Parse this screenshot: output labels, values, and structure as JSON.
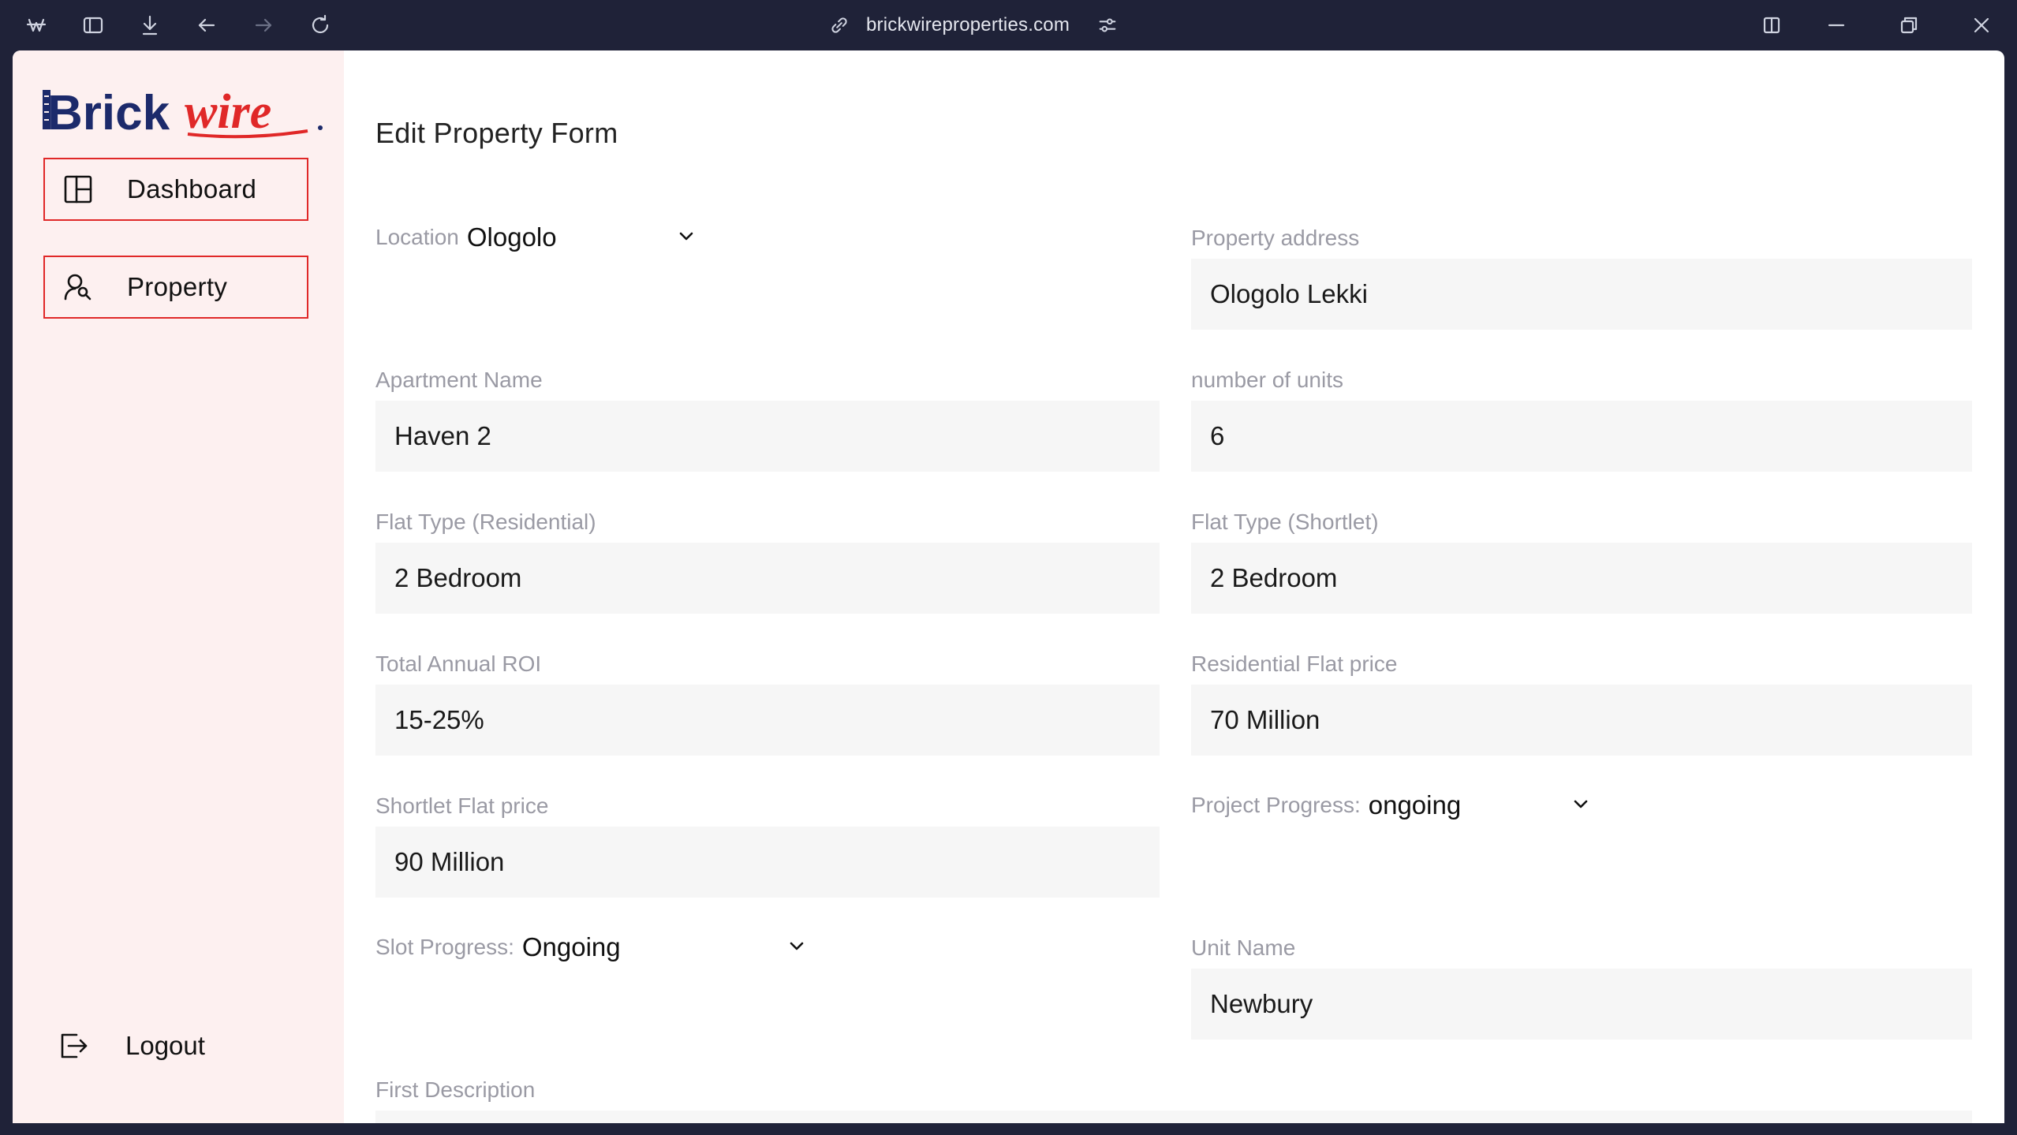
{
  "browser": {
    "url": "brickwireproperties.com"
  },
  "sidebar": {
    "logo_text": "Brickwire",
    "items": [
      {
        "label": "Dashboard",
        "icon": "dashboard-layout-icon"
      },
      {
        "label": "Property",
        "icon": "user-search-icon"
      }
    ],
    "logout_label": "Logout"
  },
  "form": {
    "title": "Edit Property Form",
    "location": {
      "label": "Location",
      "value": "Ologolo"
    },
    "property_address": {
      "label": "Property address",
      "value": "Ologolo Lekki"
    },
    "apartment_name": {
      "label": "Apartment Name",
      "value": "Haven 2"
    },
    "number_of_units": {
      "label": "number of units",
      "value": "6"
    },
    "flat_type_residential": {
      "label": "Flat Type (Residential)",
      "value": "2 Bedroom"
    },
    "flat_type_shortlet": {
      "label": "Flat Type (Shortlet)",
      "value": "2 Bedroom"
    },
    "total_annual_roi": {
      "label": "Total Annual ROI",
      "value": "15-25%"
    },
    "residential_flat_price": {
      "label": "Residential Flat price",
      "value": "70 Million"
    },
    "shortlet_flat_price": {
      "label": "Shortlet Flat price",
      "value": "90 Million"
    },
    "project_progress": {
      "label": "Project Progress:",
      "value": "ongoing"
    },
    "slot_progress": {
      "label": "Slot Progress:",
      "value": "Ongoing"
    },
    "unit_name": {
      "label": "Unit Name",
      "value": "Newbury"
    },
    "first_description": {
      "label": "First Description"
    }
  },
  "colors": {
    "accent_red": "#e02828",
    "logo_navy": "#1c2a6b",
    "sidebar_bg": "#fdf0f0",
    "chrome_bg": "#1f2238"
  }
}
